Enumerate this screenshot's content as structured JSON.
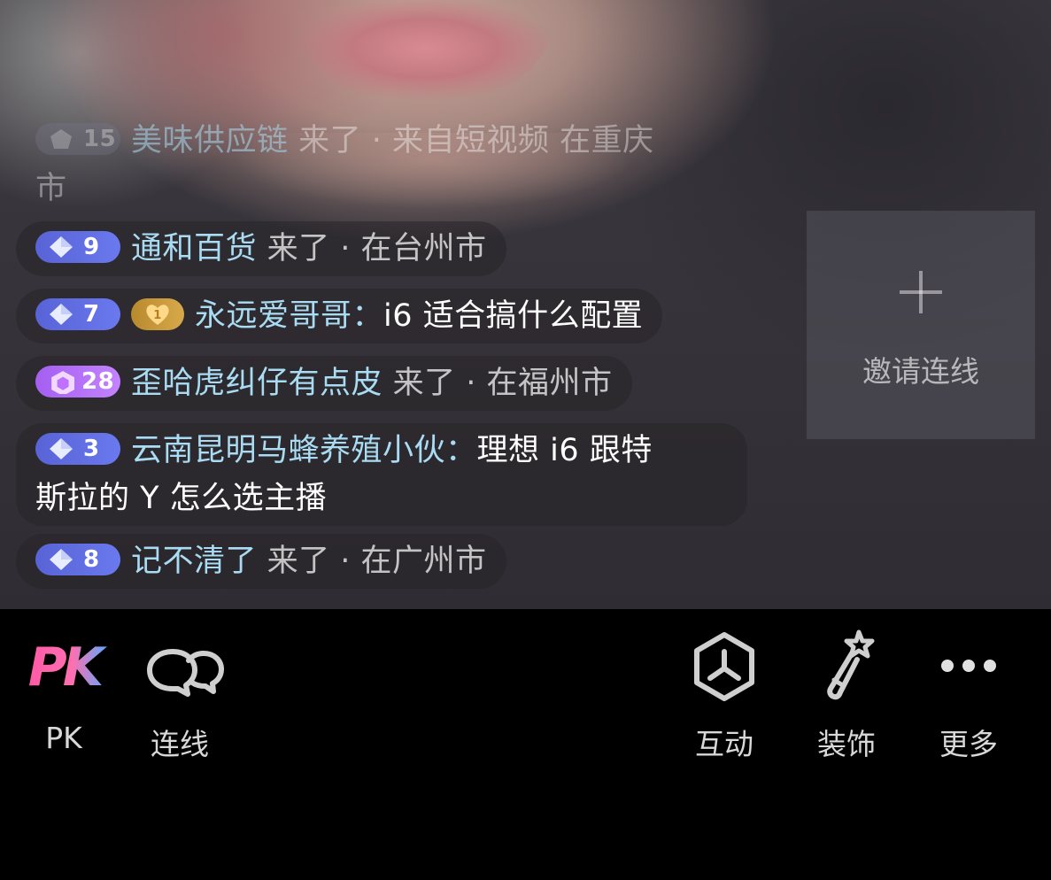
{
  "chat": {
    "messages": [
      {
        "level": "15",
        "user": "美味供应链",
        "tail_line1": " 来了 · 来自短视频 在重庆",
        "tail_line2": "市"
      },
      {
        "level": "9",
        "user": "通和百货",
        "tail": " 来了 · 在台州市"
      },
      {
        "level": "7",
        "fan_level": "1",
        "user": "永远爱哥哥",
        "colon": "：",
        "text": "i6 适合搞什么配置"
      },
      {
        "level": "28",
        "user": "歪哈虎纠仔有点皮",
        "tail": " 来了 · 在福州市"
      },
      {
        "level": "3",
        "user": "云南昆明马蜂养殖小伙",
        "colon": "：",
        "text_line1": "理想 i6 跟特",
        "text_line2": "斯拉的 Y 怎么选主播"
      },
      {
        "level": "8",
        "user": "记不清了",
        "tail": " 来了 · 在广州市"
      }
    ]
  },
  "invite": {
    "label": "邀请连线"
  },
  "toolbar": {
    "pk": {
      "icon_text": "PK",
      "label": "PK"
    },
    "connect": {
      "label": "连线"
    },
    "interact": {
      "label": "互动"
    },
    "decorate": {
      "label": "装饰"
    },
    "more": {
      "label": "更多"
    }
  },
  "colors": {
    "username": "#a9dcf2",
    "level_badge": "#5f6ee4",
    "purple_badge": "#b070fa",
    "pk_pink": "#ff5aa5",
    "pk_blue": "#5aa9ff"
  }
}
